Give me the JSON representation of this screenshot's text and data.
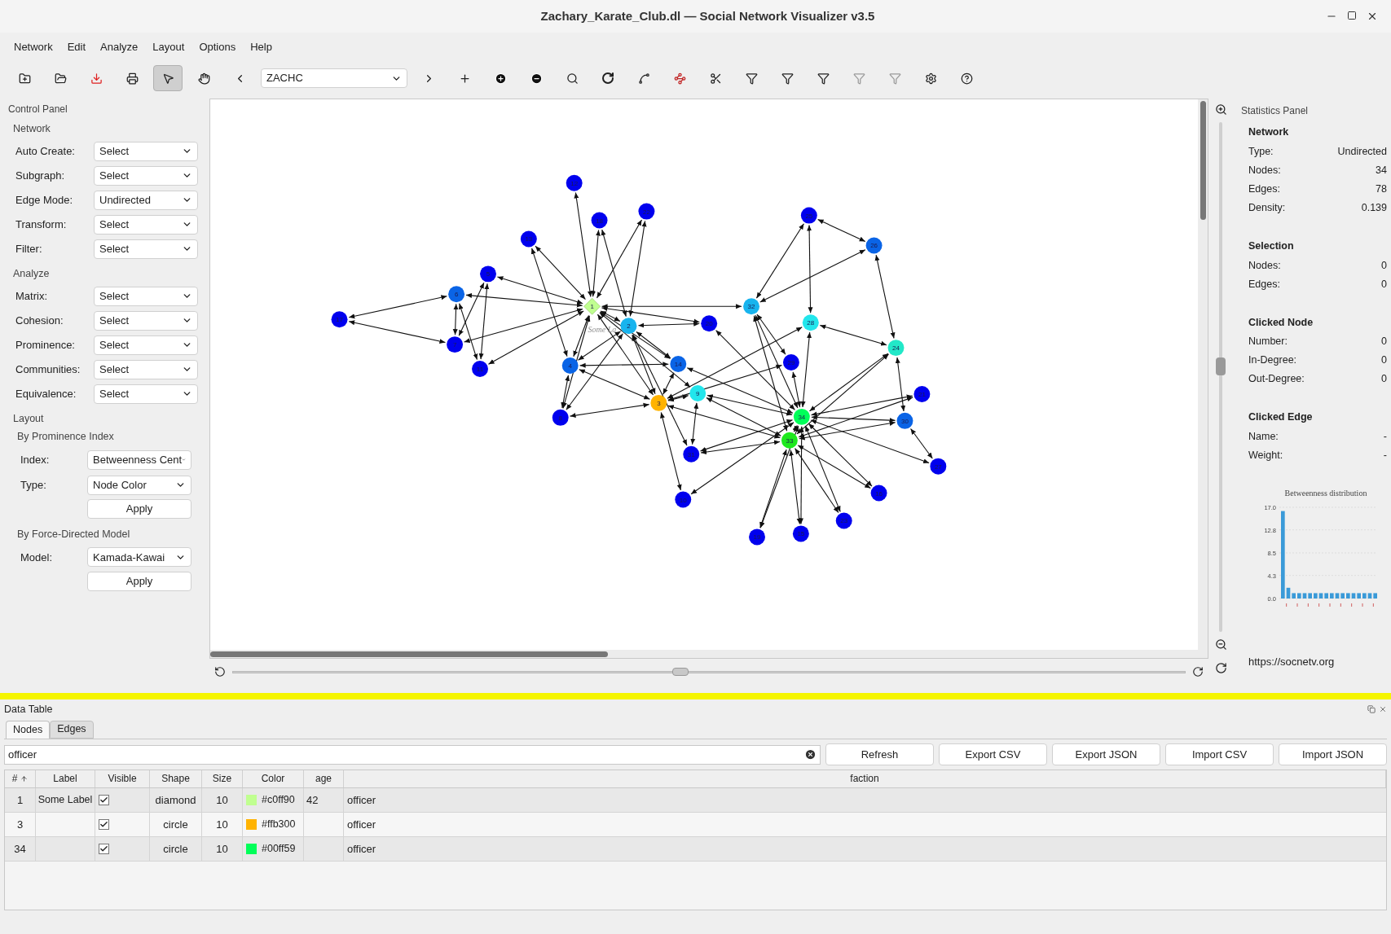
{
  "window": {
    "title": "Zachary_Karate_Club.dl — Social Network Visualizer v3.5"
  },
  "menu": [
    "Network",
    "Edit",
    "Analyze",
    "Layout",
    "Options",
    "Help"
  ],
  "toolbar": {
    "tools": [
      {
        "kind": "select",
        "selected": true
      },
      {
        "kind": "pan",
        "selected": false
      }
    ],
    "relation": "ZACHC"
  },
  "control_panel": {
    "title": "Control Panel",
    "sections": [
      {
        "title": "Network",
        "rows": [
          {
            "label": "Auto Create:",
            "value": "Select"
          },
          {
            "label": "Subgraph:",
            "value": "Select"
          },
          {
            "label": "Edge Mode:",
            "value": "Undirected"
          },
          {
            "label": "Transform:",
            "value": "Select"
          },
          {
            "label": "Filter:",
            "value": "Select"
          }
        ]
      },
      {
        "title": "Analyze",
        "rows": [
          {
            "label": "Matrix:",
            "value": "Select"
          },
          {
            "label": "Cohesion:",
            "value": "Select"
          },
          {
            "label": "Prominence:",
            "value": "Select"
          },
          {
            "label": "Communities:",
            "value": "Select"
          },
          {
            "label": "Equivalence:",
            "value": "Select"
          }
        ]
      }
    ],
    "layout": {
      "title": "Layout",
      "groups": [
        {
          "title": "By Prominence Index",
          "rows": [
            {
              "label": "Index:",
              "value": "Betweenness Cent"
            },
            {
              "label": "Type:",
              "value": "Node Color"
            }
          ],
          "button": "Apply"
        },
        {
          "title": "By Force-Directed Model",
          "rows": [
            {
              "label": "Model:",
              "value": "Kamada-Kawai"
            }
          ],
          "button": "Apply"
        }
      ]
    }
  },
  "graph": {
    "node_label": "Some La",
    "nodes": [
      {
        "label": "1",
        "kind": "diamond",
        "color": "#c0ff90"
      },
      {
        "label": "2",
        "kind": "circle",
        "color": "#18b4ee"
      },
      {
        "label": "3",
        "kind": "circle",
        "color": "#ffb300"
      },
      {
        "label": "4",
        "kind": "circle",
        "color": "#0a64e6"
      },
      {
        "label": "5",
        "kind": "circle",
        "color": "#0000ee"
      },
      {
        "label": "6",
        "kind": "circle",
        "color": "#0a64e6"
      },
      {
        "label": "7",
        "kind": "circle",
        "color": "#0000ee"
      },
      {
        "label": "8",
        "kind": "circle",
        "color": "#0000ee"
      },
      {
        "label": "9",
        "kind": "circle",
        "color": "#22e6ec"
      },
      {
        "label": "10",
        "kind": "circle",
        "color": "#0000ee"
      },
      {
        "label": "11",
        "kind": "circle",
        "color": "#0000ee"
      },
      {
        "label": "12",
        "kind": "circle",
        "color": "#0000ee"
      },
      {
        "label": "13",
        "kind": "circle",
        "color": "#0000ee"
      },
      {
        "label": "14",
        "kind": "circle",
        "color": "#0a64e6"
      },
      {
        "label": "15",
        "kind": "circle",
        "color": "#0000ee"
      },
      {
        "label": "16",
        "kind": "circle",
        "color": "#0000ee"
      },
      {
        "label": "17",
        "kind": "circle",
        "color": "#0000ee"
      },
      {
        "label": "18",
        "kind": "circle",
        "color": "#0000ee"
      },
      {
        "label": "19",
        "kind": "circle",
        "color": "#0000ee"
      },
      {
        "label": "20",
        "kind": "circle",
        "color": "#0000ee"
      },
      {
        "label": "21",
        "kind": "circle",
        "color": "#0000ee"
      },
      {
        "label": "22",
        "kind": "circle",
        "color": "#0000ee"
      },
      {
        "label": "23",
        "kind": "circle",
        "color": "#0000ee"
      },
      {
        "label": "24",
        "kind": "circle",
        "color": "#22e8c8"
      },
      {
        "label": "25",
        "kind": "circle",
        "color": "#0000ee"
      },
      {
        "label": "26",
        "kind": "circle",
        "color": "#0a64e6"
      },
      {
        "label": "27",
        "kind": "circle",
        "color": "#0000ee"
      },
      {
        "label": "28",
        "kind": "circle",
        "color": "#22e6ec"
      },
      {
        "label": "29",
        "kind": "circle",
        "color": "#0000ee"
      },
      {
        "label": "30",
        "kind": "circle",
        "color": "#0a64e6"
      },
      {
        "label": "31",
        "kind": "circle",
        "color": "#0000ee"
      },
      {
        "label": "32",
        "kind": "circle",
        "color": "#18b4ee"
      },
      {
        "label": "33",
        "kind": "circle",
        "color": "#1ee81e"
      },
      {
        "label": "34",
        "kind": "circle",
        "color": "#00ff59"
      }
    ],
    "rotation": {
      "level": 0.47
    },
    "zoom": {
      "level": 0.52
    }
  },
  "statistics": {
    "title": "Statistics Panel",
    "sections": [
      {
        "title": "Network",
        "rows": [
          {
            "label": "Type:",
            "value": "Undirected"
          },
          {
            "label": "Nodes:",
            "value": "34"
          },
          {
            "label": "Edges:",
            "value": "78"
          },
          {
            "label": "Density:",
            "value": "0.139"
          }
        ]
      },
      {
        "title": "Selection",
        "rows": [
          {
            "label": "Nodes:",
            "value": "0"
          },
          {
            "label": "Edges:",
            "value": "0"
          }
        ]
      },
      {
        "title": "Clicked Node",
        "rows": [
          {
            "label": "Number:",
            "value": "0"
          },
          {
            "label": "In-Degree:",
            "value": "0"
          },
          {
            "label": "Out-Degree:",
            "value": "0"
          }
        ]
      },
      {
        "title": "Clicked Edge",
        "rows": [
          {
            "label": "Name:",
            "value": "-"
          },
          {
            "label": "Weight:",
            "value": "-"
          }
        ]
      }
    ],
    "chart_data": {
      "type": "bar",
      "grid": true,
      "title": "Betweenness distribution",
      "ylim": [
        0,
        17
      ],
      "yticks": [
        {
          "value": 0,
          "label": "0.0"
        },
        {
          "value": 4.3,
          "label": "4.3"
        },
        {
          "value": 8.5,
          "label": "8.5"
        },
        {
          "value": 12.8,
          "label": "12.8"
        },
        {
          "value": 17,
          "label": "17.0"
        }
      ],
      "series": [
        {
          "color": "#3a9ad8",
          "values": [
            16.3,
            2,
            1,
            1,
            1,
            1,
            1,
            1,
            1,
            1,
            1,
            1,
            1,
            1,
            1,
            1,
            1,
            1
          ]
        }
      ]
    },
    "url": "https://socnetv.org"
  },
  "data_table": {
    "title": "Data Table",
    "tabs": [
      {
        "label": "Nodes",
        "selected": true
      },
      {
        "label": "Edges",
        "selected": false
      }
    ],
    "filter": {
      "value": "officer"
    },
    "buttons": [
      "Refresh",
      "Export CSV",
      "Export JSON",
      "Import CSV",
      "Import JSON"
    ],
    "columns": [
      {
        "label": "#",
        "sorted": true
      },
      {
        "label": "Label",
        "sorted": false
      },
      {
        "label": "Visible",
        "sorted": false
      },
      {
        "label": "Shape",
        "sorted": false
      },
      {
        "label": "Size",
        "sorted": false
      },
      {
        "label": "Color",
        "sorted": false
      },
      {
        "label": "age",
        "sorted": false
      },
      {
        "label": "faction",
        "sorted": false
      }
    ],
    "rows": [
      {
        "number": "1",
        "label": "Some Label",
        "visible": true,
        "shape": "diamond",
        "size": "10",
        "color": "#c0ff90",
        "age": "42",
        "faction": "officer"
      },
      {
        "number": "3",
        "visible": true,
        "shape": "circle",
        "size": "10",
        "color": "#ffb300",
        "faction": "officer"
      },
      {
        "number": "34",
        "visible": true,
        "shape": "circle",
        "size": "10",
        "color": "#00ff59",
        "faction": "officer"
      }
    ]
  }
}
